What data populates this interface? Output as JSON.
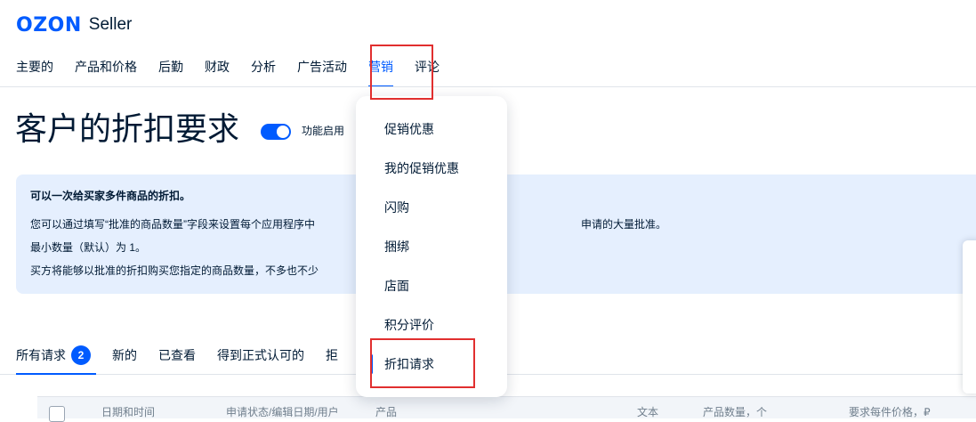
{
  "header": {
    "logo_text": "OZON",
    "logo_sub": "Seller"
  },
  "nav": {
    "items": [
      "主要的",
      "产品和价格",
      "后勤",
      "财政",
      "分析",
      "广告活动",
      "营销",
      "评论"
    ],
    "active": "营销"
  },
  "page": {
    "title": "客户的折扣要求",
    "toggle_label": "功能启用",
    "toggle_on": true
  },
  "info": {
    "heading": "可以一次给买家多件商品的折扣。",
    "line1a": "您可以通过填写“批准的商品数量”字段来设置每个应用程序中",
    "line1b": "申请的大量批准。",
    "line2": "最小数量（默认）为 1。",
    "line3": "买方将能够以批准的折扣购买您指定的商品数量，不多也不少"
  },
  "tabs": {
    "items": [
      "所有请求",
      "新的",
      "已查看",
      "得到正式认可的",
      "拒"
    ],
    "badge_count": "2"
  },
  "table": {
    "headers": [
      "日期和时间",
      "申请状态/编辑日期/用户",
      "产品",
      "文本",
      "产品数量，个",
      "要求每件价格，₽"
    ]
  },
  "dropdown": {
    "items": [
      "促销优惠",
      "我的促销优惠",
      "闪购",
      "捆绑",
      "店面",
      "积分评价",
      "折扣请求"
    ],
    "active": "折扣请求"
  },
  "colors": {
    "accent": "#005bff",
    "highlight": "#e12f2f",
    "info_bg": "#e5effe"
  }
}
